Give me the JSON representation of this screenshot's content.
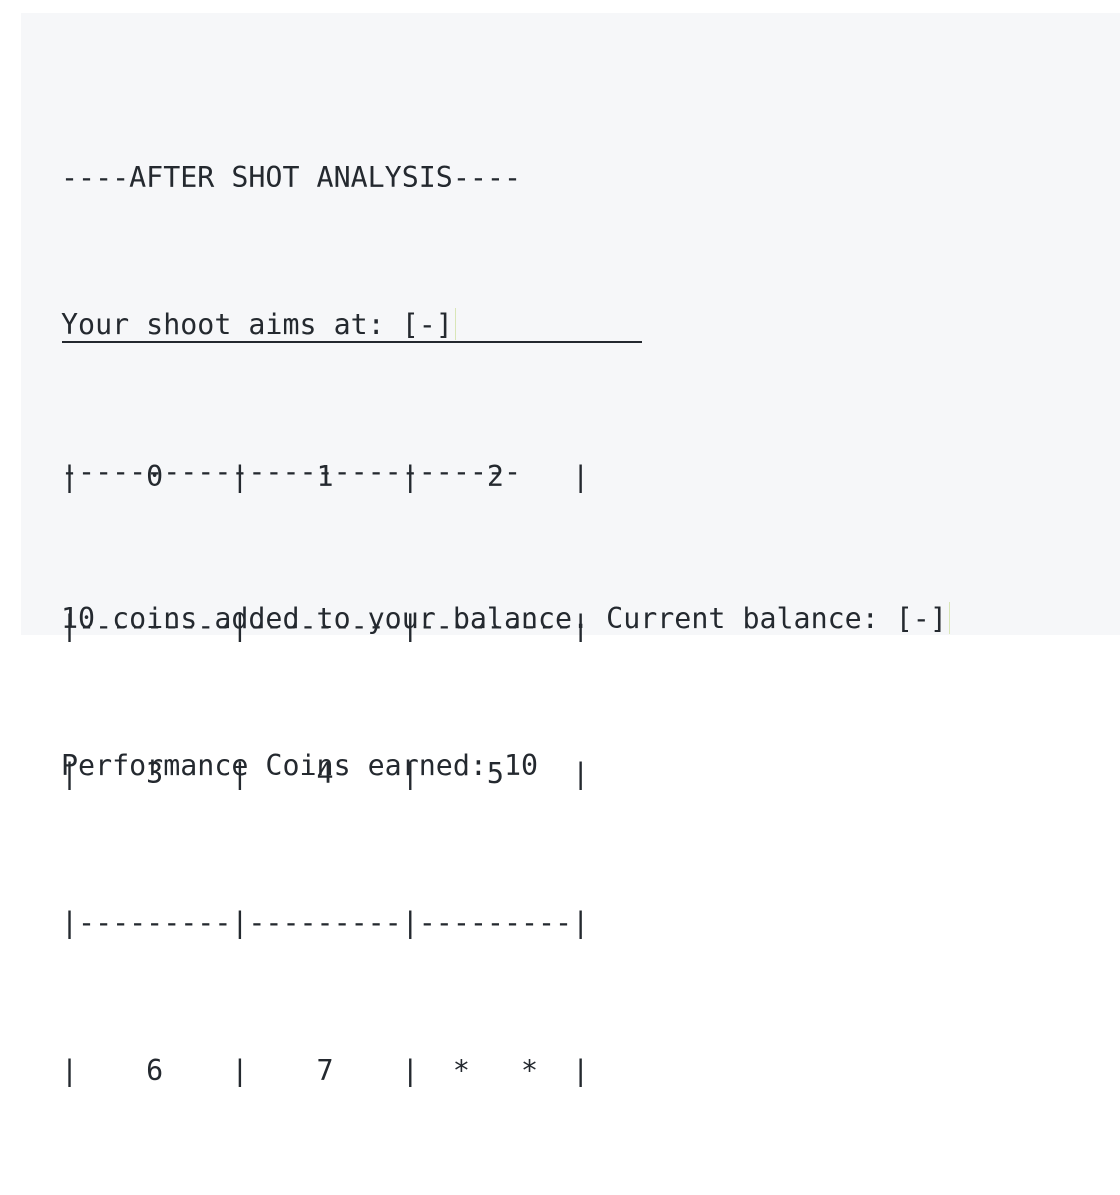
{
  "output": {
    "header_line": "----AFTER SHOT ANALYSIS----",
    "aim_line": "Your shoot aims at: [-]",
    "separator_line": "---------------------------",
    "coins_line": "10 coins added to your balance. Current balance: [-]",
    "performance_line": "Performance Coins earned: 10"
  },
  "board": {
    "rows": [
      "|    0    |    1    |    2    |",
      "|---------|---------|---------|",
      "|    3    |    4    |    5    |",
      "|---------|---------|---------|",
      "|    6    |    7    |  *   *  |"
    ]
  }
}
